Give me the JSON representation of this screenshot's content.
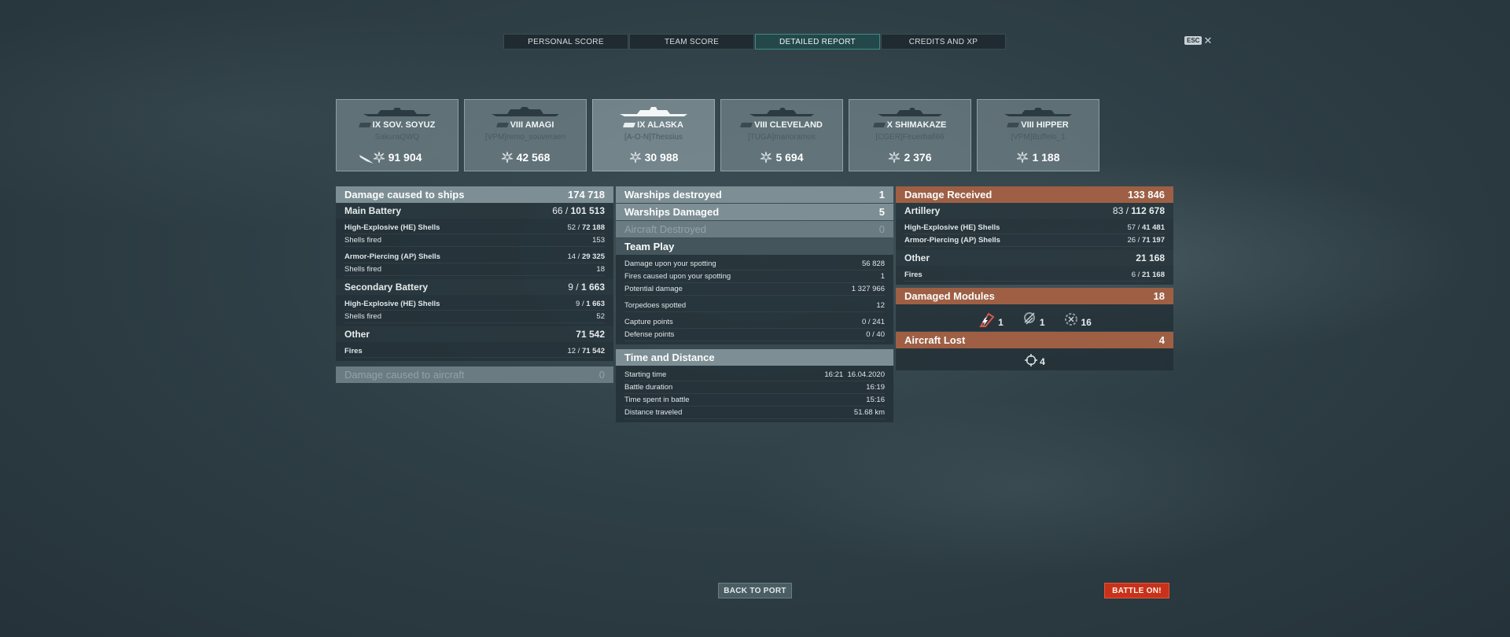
{
  "tabs": [
    {
      "label": "PERSONAL SCORE",
      "active": false
    },
    {
      "label": "TEAM SCORE",
      "active": false
    },
    {
      "label": "DETAILED REPORT",
      "active": true
    },
    {
      "label": "CREDITS AND XP",
      "active": false
    }
  ],
  "esc": {
    "key": "ESC",
    "close": "✕"
  },
  "ships": [
    {
      "name": "IX SOV. SOYUZ",
      "player": "SakuraQWQ",
      "damage": "91 904",
      "has_plane": true
    },
    {
      "name": "VIII AMAGI",
      "player": "[VPM]remo_souveraen",
      "damage": "42 568"
    },
    {
      "name": "IX ALASKA",
      "player": "[A-O-N]Thessius",
      "damage": "30 988",
      "me": true
    },
    {
      "name": "VIII CLEVELAND",
      "player": "[TUGA]marioramos",
      "damage": "5 694"
    },
    {
      "name": "X SHIMAKAZE",
      "player": "[CGER]Feuerball66",
      "damage": "2 376"
    },
    {
      "name": "VIII HIPPER",
      "player": "[VPM]Buffelo_1",
      "damage": "1 188"
    }
  ],
  "left": {
    "damage_ships": {
      "label": "Damage caused to ships",
      "value": "174 718"
    },
    "main_battery": {
      "label": "Main Battery",
      "hits": "66 / ",
      "dmg": "101 513"
    },
    "mb_he": {
      "label": "High-Explosive (HE) Shells",
      "hits": "52 / ",
      "dmg": "72 188"
    },
    "mb_he_fired": {
      "label": "Shells fired",
      "value": "153"
    },
    "mb_ap": {
      "label": "Armor-Piercing (AP) Shells",
      "hits": "14 / ",
      "dmg": "29 325"
    },
    "mb_ap_fired": {
      "label": "Shells fired",
      "value": "18"
    },
    "secondary": {
      "label": "Secondary Battery",
      "hits": "9 / ",
      "dmg": "1 663"
    },
    "sec_he": {
      "label": "High-Explosive (HE) Shells",
      "hits": "9 / ",
      "dmg": "1 663"
    },
    "sec_fired": {
      "label": "Shells fired",
      "value": "52"
    },
    "other": {
      "label": "Other",
      "value": "71 542"
    },
    "fires": {
      "label": "Fires",
      "hits": "12 / ",
      "dmg": "71 542"
    },
    "damage_aircraft": {
      "label": "Damage caused to aircraft",
      "value": "0"
    }
  },
  "middle": {
    "destroyed": {
      "label": "Warships destroyed",
      "value": "1"
    },
    "damaged": {
      "label": "Warships Damaged",
      "value": "5"
    },
    "aircraft": {
      "label": "Aircraft Destroyed",
      "value": "0"
    },
    "teamplay": {
      "label": "Team Play"
    },
    "tp_rows": [
      {
        "label": "Damage upon your spotting",
        "value": "56 828"
      },
      {
        "label": "Fires caused upon your spotting",
        "value": "1"
      },
      {
        "label": "Potential damage",
        "value": "1 327 966"
      },
      {
        "label": "Torpedoes spotted",
        "value": "12"
      },
      {
        "label": "Capture points",
        "value": "0 / 241"
      },
      {
        "label": "Defense points",
        "value": "0 / 40"
      }
    ],
    "time": {
      "label": "Time and Distance"
    },
    "td_rows": [
      {
        "label": "Starting time",
        "value": "16:21  16.04.2020"
      },
      {
        "label": "Battle duration",
        "value": "16:19"
      },
      {
        "label": "Time spent in battle",
        "value": "15:16"
      },
      {
        "label": "Distance traveled",
        "value": "51.68 km"
      }
    ]
  },
  "right": {
    "received": {
      "label": "Damage Received",
      "value": "133 846"
    },
    "artillery": {
      "label": "Artillery",
      "hits": "83 / ",
      "dmg": "112 678"
    },
    "he": {
      "label": "High-Explosive (HE) Shells",
      "hits": "57 / ",
      "dmg": "41 481"
    },
    "ap": {
      "label": "Armor-Piercing (AP) Shells",
      "hits": "26 / ",
      "dmg": "71 197"
    },
    "other": {
      "label": "Other",
      "value": "21 168"
    },
    "fires": {
      "label": "Fires",
      "hits": "6 / ",
      "dmg": "21 168"
    },
    "modules": {
      "label": "Damaged Modules",
      "value": "18"
    },
    "module_counts": [
      "1",
      "1",
      "16"
    ],
    "aircraft_lost": {
      "label": "Aircraft Lost",
      "value": "4"
    },
    "aircraft_count": "4"
  },
  "buttons": {
    "back": "BACK TO PORT",
    "battle": "BATTLE ON!"
  }
}
